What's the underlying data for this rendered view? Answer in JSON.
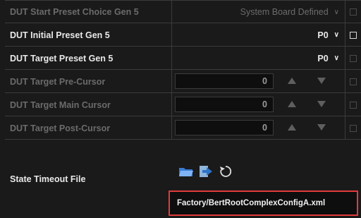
{
  "rows": [
    {
      "label": "DUT Start Preset Choice Gen 5",
      "value": "System Board Defined",
      "enabled": false
    },
    {
      "label": "DUT Initial Preset Gen 5",
      "value": "P0",
      "enabled": true
    },
    {
      "label": "DUT Target Preset Gen 5",
      "value": "P0",
      "enabled": true
    },
    {
      "label": "DUT Target Pre-Cursor",
      "value": "0",
      "enabled": false
    },
    {
      "label": "DUT Target Main Cursor",
      "value": "0",
      "enabled": false
    },
    {
      "label": "DUT Target Post-Cursor",
      "value": "0",
      "enabled": false
    }
  ],
  "state_timeout": {
    "label": "State Timeout File",
    "file_path": "Factory/BertRootComplexConfigA.xml",
    "icons": [
      "open-folder-icon",
      "import-icon",
      "reset-icon"
    ]
  },
  "colors": {
    "background": "#1a1a1a",
    "highlight_border": "#e23b3b",
    "disabled_text": "#6b6b6b",
    "enabled_text": "#e9e9e9"
  }
}
